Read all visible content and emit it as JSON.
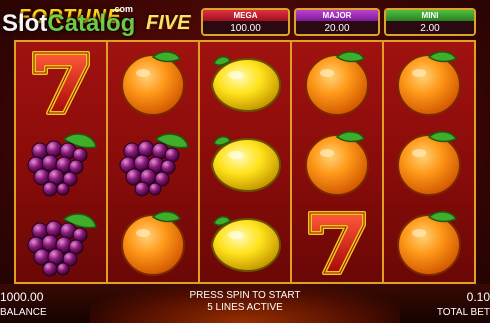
{
  "header": {
    "logo_title": "FORTUNE",
    "logo_sub": ".com",
    "logo_five": "FIVE",
    "watermark_main": "Slot",
    "watermark_accent": "Catalog"
  },
  "jackpots": [
    {
      "label": "MEGA",
      "value": "100.00",
      "color": "#e03040"
    },
    {
      "label": "MAJOR",
      "value": "20.00",
      "color": "#c040d0"
    },
    {
      "label": "MINI",
      "value": "2.00",
      "color": "#4fc040"
    }
  ],
  "reels": [
    [
      "seven",
      "grapes",
      "grapes"
    ],
    [
      "orange",
      "grapes",
      "orange"
    ],
    [
      "lemon",
      "lemon",
      "lemon"
    ],
    [
      "orange",
      "orange",
      "seven"
    ],
    [
      "orange",
      "orange",
      "orange"
    ]
  ],
  "footer": {
    "balance_value": "1000.00",
    "balance_label": "BALANCE",
    "message_line1": "PRESS SPIN TO START",
    "message_line2": "5 LINES ACTIVE",
    "total_value": "0.10",
    "total_label": "TOTAL BET"
  },
  "colors": {
    "reel_border": "#e0a020",
    "reel_bg": "#8a0c0a"
  }
}
